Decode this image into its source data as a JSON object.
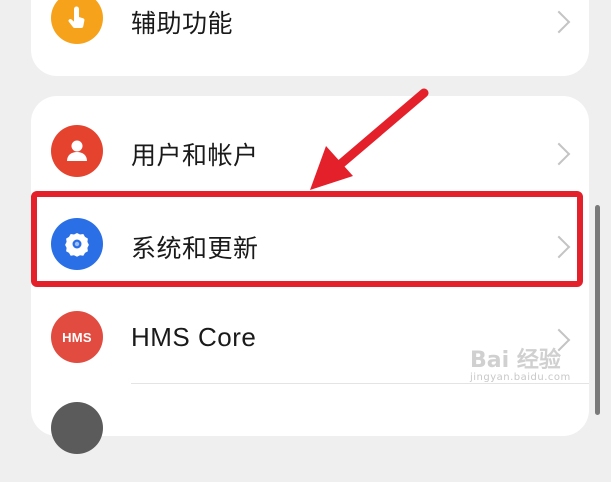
{
  "settings": {
    "items": [
      {
        "label": "辅助功能",
        "icon": "accessibility-icon",
        "icon_color": "#f7a21b"
      },
      {
        "label": "用户和帐户",
        "icon": "user-icon",
        "icon_color": "#e6432f"
      },
      {
        "label": "系统和更新",
        "icon": "gear-icon",
        "icon_color": "#2b6fe6"
      },
      {
        "label": "HMS Core",
        "icon": "hms-icon",
        "icon_color": "#e24b3f",
        "icon_text": "HMS"
      }
    ]
  },
  "annotation": {
    "highlight_color": "#e4202a",
    "arrow_color": "#e4202a"
  },
  "watermark": {
    "main": "Bai 经验",
    "sub": "jingyan.baidu.com"
  }
}
